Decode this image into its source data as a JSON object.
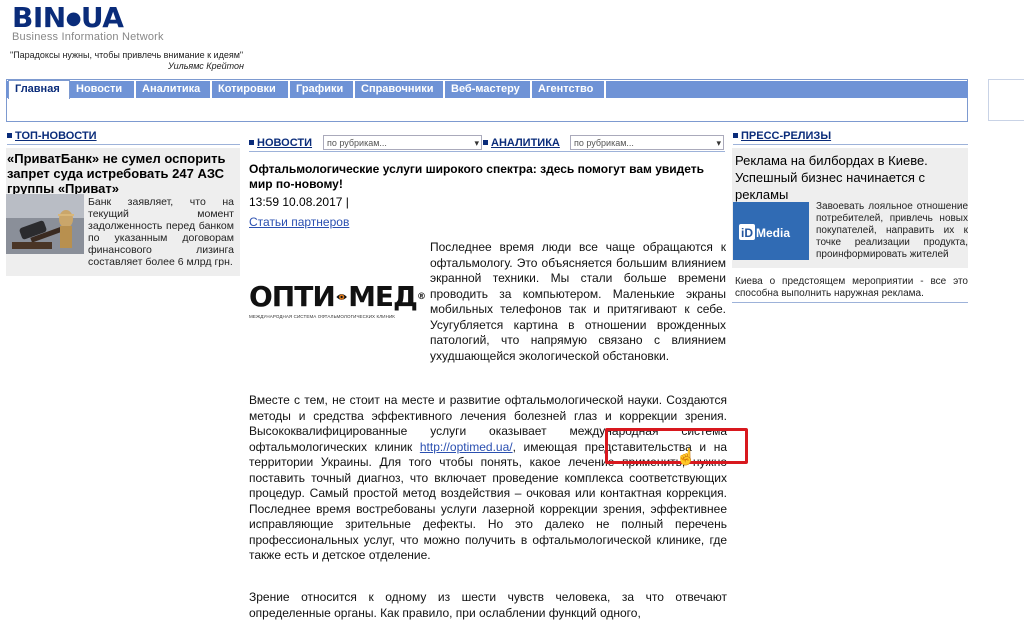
{
  "header": {
    "logo_main": "BIN",
    "logo_dot": "●",
    "logo_suffix": "UA",
    "logo_sub": "Business Information Network",
    "quote_text": "\"Парадоксы нужны, чтобы привлечь внимание к идеям\"",
    "quote_author": "Уильямс Крейтон"
  },
  "nav": {
    "tabs": [
      {
        "label": "Главная"
      },
      {
        "label": "Новости"
      },
      {
        "label": "Аналитика"
      },
      {
        "label": "Котировки"
      },
      {
        "label": "Графики"
      },
      {
        "label": "Справочники"
      },
      {
        "label": "Веб-мастеру"
      },
      {
        "label": "Агентство"
      }
    ],
    "active_index": 0
  },
  "left": {
    "heading": "ТОП-НОВОСТИ",
    "title": "«ПриватБанк» не сумел оспорить запрет суда истребовать 247 АЗС группы «Приват»",
    "text": "Банк заявляет, что на текущий момент задолженность перед банком по указанным договорам финансового лизинга составляет более 6 млрд грн."
  },
  "middle": {
    "news_heading": "НОВОСТИ",
    "news_select": "по рубрикам...",
    "analytics_heading": "АНАЛИТИКА",
    "analytics_select": "по рубрикам...",
    "article_title": "Офтальмологические услуги широкого спектра: здесь помогут вам увидеть мир по-новому!",
    "article_date": "13:59 10.08.2017 |",
    "article_category": "Статьи партнеров",
    "brand_left": "ОПТИ",
    "brand_right": "МЕД",
    "brand_reg": "®",
    "brand_tag": "МЕЖДУНАРОДНАЯ СИСТЕМА ОФТАЛЬМОЛОГИЧЕСКИХ КЛИНИК",
    "para1": "Последнее время люди все чаще обращаются к офтальмологу. Это объясняется большим влиянием экранной техники. Мы стали больше времени проводить за компьютером. Маленькие экраны мобильных телефонов так и притягивают к себе. Усугубляется картина в отношении врожденных патологий, что напрямую связано с влиянием ухудшающейся экологической обстановки.",
    "para2_a": "Вместе с тем, не стоит на месте и развитие офтальмологической науки. Создаются методы и средства эффективного лечения болезней глаз и коррекции зрения. Высококвалифицированные услуги оказывает международная система офтальмологических клиник ",
    "para2_link": "http://optimed.ua/",
    "para2_b": ", имеющая представительства и на территории Украины. Для того чтобы понять, какое лечение применить, нужно поставить точный диагноз, что включает проведение комплекса соответствующих процедур. Самый простой метод воздействия – очковая или контактная коррекция. Последнее время востребованы услуги лазерной коррекции зрения, эффективнее исправляющие зрительные дефекты. Но это далеко не полный перечень профессиональных услуг, что можно получить в офтальмологической клинике, где также есть и детское отделение.",
    "para3": "Зрение относится к одному из шести чувств человека, за что отвечают определенные органы. Как правило, при ослаблении функций одного,"
  },
  "right": {
    "heading": "ПРЕСС-РЕЛИЗЫ",
    "title": "Реклама на билбордах в Киеве. Успешный бизнес начинается с рекламы",
    "img_label": "iD Media",
    "text": "Завоевать лояльное отношение потребителей, привлечь новых покупателей, направить их к точке реализации продукта, проинформировать жителей",
    "text2": "Киева о предстоящем мероприятии - все это способна выполнить наружная реклама."
  },
  "colors": {
    "brand_blue": "#0a2c7a",
    "nav_blue": "#6f93d6",
    "link_blue": "#2a4fb0",
    "highlight_red": "#d8181e"
  }
}
